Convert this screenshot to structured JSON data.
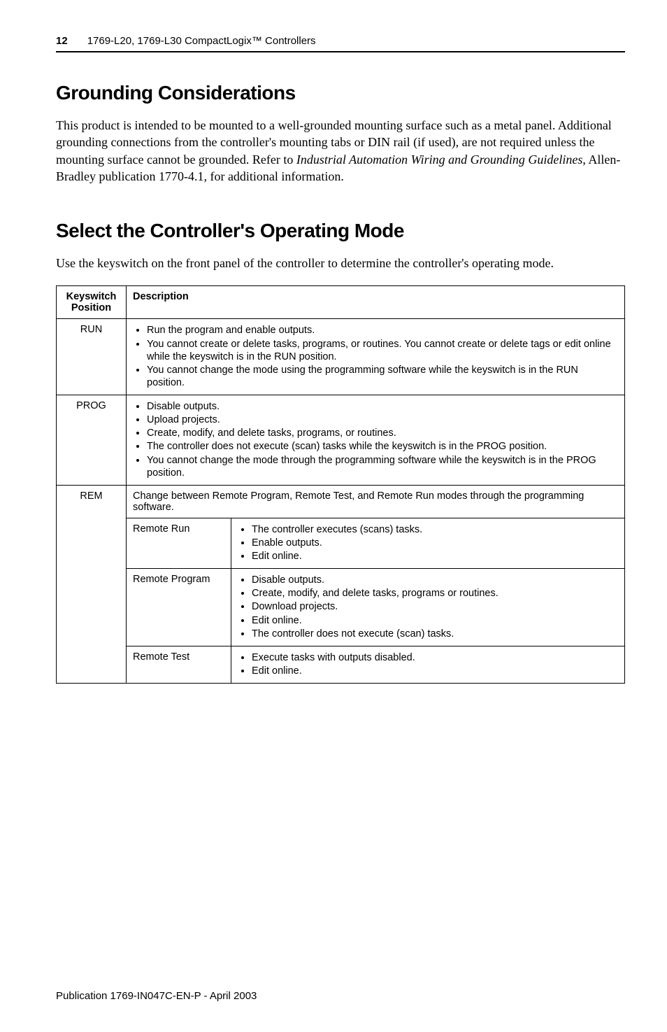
{
  "header": {
    "pageNumber": "12",
    "title": "1769-L20, 1769-L30 CompactLogix™ Controllers"
  },
  "section1": {
    "title": "Grounding Considerations",
    "body": "This product is intended to be mounted to a well-grounded mounting surface such as a metal panel. Additional grounding connections from the controller's mounting tabs or DIN rail (if used), are not required unless the mounting surface cannot be grounded. Refer to Industrial Automation Wiring and Grounding Guidelines, Allen-Bradley publication 1770-4.1, for additional information.",
    "italic": "Industrial Automation Wiring and Grounding Guidelines"
  },
  "section2": {
    "title": "Select the Controller's Operating Mode",
    "body": "Use the keyswitch on the front panel of the controller to determine the controller's operating mode."
  },
  "table": {
    "head": {
      "c1": "Keyswitch Position",
      "c2": "Description"
    },
    "rows": {
      "run": {
        "label": "RUN",
        "items": [
          "Run the program and enable outputs.",
          "You cannot create or delete tasks, programs, or routines. You cannot create or delete tags or edit online while the keyswitch is in the RUN position.",
          "You cannot change the mode using the programming software while the keyswitch is in the RUN position."
        ]
      },
      "prog": {
        "label": "PROG",
        "items": [
          "Disable outputs.",
          "Upload projects.",
          "Create, modify, and delete tasks, programs, or routines.",
          "The controller does not execute (scan) tasks while the keyswitch is in the PROG position.",
          "You cannot change the mode through the programming software while the keyswitch is in the PROG position."
        ]
      },
      "rem": {
        "label": "REM",
        "intro": "Change between Remote Program, Remote Test, and Remote Run modes through the programming software.",
        "remoteRun": {
          "label": "Remote Run",
          "items": [
            "The controller executes (scans) tasks.",
            "Enable outputs.",
            "Edit online."
          ]
        },
        "remoteProgram": {
          "label": "Remote Program",
          "items": [
            "Disable outputs.",
            "Create, modify, and delete tasks, programs or routines.",
            "Download projects.",
            "Edit online.",
            "The controller does not execute (scan) tasks."
          ]
        },
        "remoteTest": {
          "label": "Remote Test",
          "items": [
            "Execute tasks with outputs disabled.",
            "Edit online."
          ]
        }
      }
    }
  },
  "footer": "Publication 1769-IN047C-EN-P - April 2003"
}
